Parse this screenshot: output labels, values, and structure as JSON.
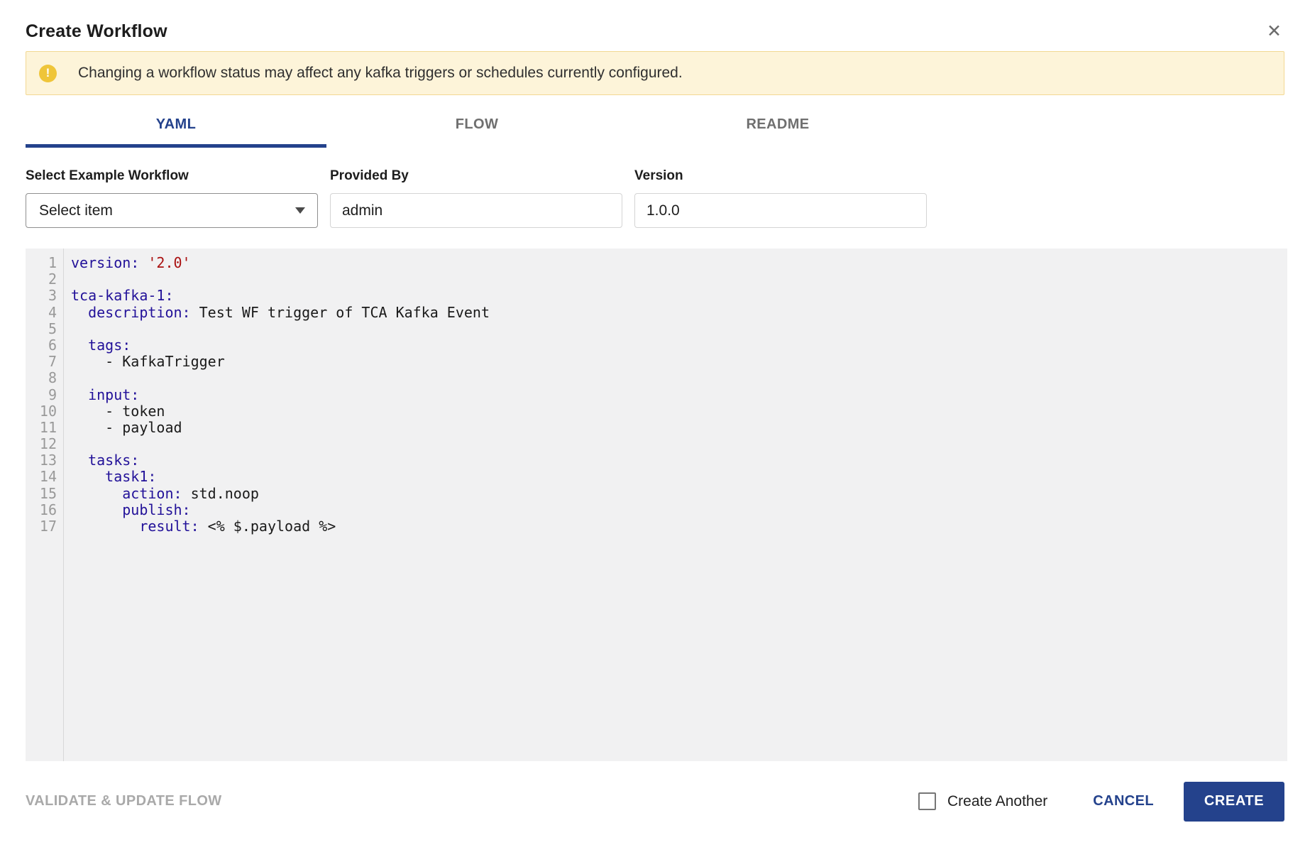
{
  "colors": {
    "navy": "#24428c",
    "tab_inactive": "#6f6f6f",
    "warning_bg": "#fdf4d9",
    "warning_border": "#f2d892",
    "warning_icon": "#efc539",
    "editor_bg": "#f1f1f2",
    "line_number": "#999999",
    "code_key": "#221199",
    "code_string": "#aa1111",
    "code_text": "#1a1a1a"
  },
  "icons": {
    "close": "✕",
    "warning": "!"
  },
  "modal": {
    "title": "Create Workflow"
  },
  "banner": {
    "text": "Changing a workflow status may affect any kafka triggers or schedules currently configured."
  },
  "tabs": [
    {
      "label": "YAML",
      "active": true
    },
    {
      "label": "FLOW",
      "active": false
    },
    {
      "label": "README",
      "active": false
    }
  ],
  "form": {
    "example_workflow": {
      "label": "Select Example Workflow",
      "value": "Select item"
    },
    "provided_by": {
      "label": "Provided By",
      "value": "admin"
    },
    "version": {
      "label": "Version",
      "value": "1.0.0"
    }
  },
  "editor": {
    "lines": [
      {
        "n": "1",
        "seg": [
          [
            "k",
            "version:"
          ],
          [
            "t",
            " "
          ],
          [
            "s",
            "'2.0'"
          ]
        ]
      },
      {
        "n": "2",
        "seg": []
      },
      {
        "n": "3",
        "seg": [
          [
            "k",
            "tca-kafka-1:"
          ]
        ]
      },
      {
        "n": "4",
        "seg": [
          [
            "k",
            "  description:"
          ],
          [
            "t",
            " Test WF trigger of TCA Kafka Event"
          ]
        ]
      },
      {
        "n": "5",
        "seg": []
      },
      {
        "n": "6",
        "seg": [
          [
            "k",
            "  tags:"
          ]
        ]
      },
      {
        "n": "7",
        "seg": [
          [
            "t",
            "    - KafkaTrigger"
          ]
        ]
      },
      {
        "n": "8",
        "seg": []
      },
      {
        "n": "9",
        "seg": [
          [
            "k",
            "  input:"
          ]
        ]
      },
      {
        "n": "10",
        "seg": [
          [
            "t",
            "    - token"
          ]
        ]
      },
      {
        "n": "11",
        "seg": [
          [
            "t",
            "    - payload"
          ]
        ]
      },
      {
        "n": "12",
        "seg": []
      },
      {
        "n": "13",
        "seg": [
          [
            "k",
            "  tasks:"
          ]
        ]
      },
      {
        "n": "14",
        "seg": [
          [
            "k",
            "    task1:"
          ]
        ]
      },
      {
        "n": "15",
        "seg": [
          [
            "k",
            "      action:"
          ],
          [
            "t",
            " std.noop"
          ]
        ]
      },
      {
        "n": "16",
        "seg": [
          [
            "k",
            "      publish:"
          ]
        ]
      },
      {
        "n": "17",
        "seg": [
          [
            "k",
            "        result:"
          ],
          [
            "t",
            " <% $.payload %>"
          ]
        ]
      }
    ]
  },
  "footer": {
    "validate_label": "VALIDATE & UPDATE FLOW",
    "create_another_label": "Create Another",
    "create_another_checked": false,
    "cancel_label": "CANCEL",
    "create_label": "CREATE"
  }
}
